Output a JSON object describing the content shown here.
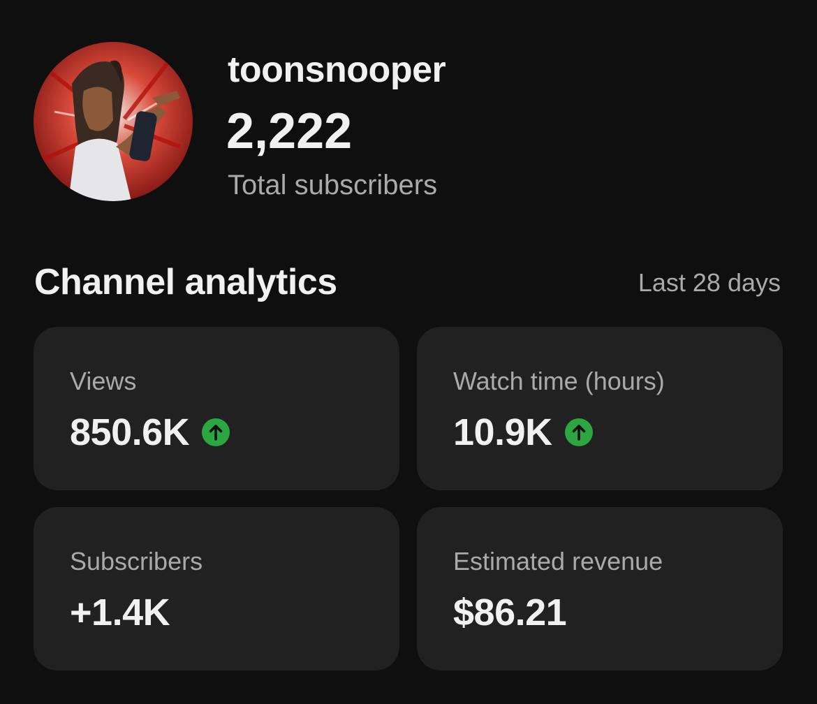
{
  "channel": {
    "name": "toonsnooper",
    "subscriber_count": "2,222",
    "subscriber_caption": "Total subscribers",
    "avatar_icon": "channel-avatar"
  },
  "analytics": {
    "title": "Channel analytics",
    "period": "Last 28 days",
    "accent_up_color": "#2ba640",
    "cards": [
      {
        "label": "Views",
        "value": "850.6K",
        "trend": "up"
      },
      {
        "label": "Watch time (hours)",
        "value": "10.9K",
        "trend": "up"
      },
      {
        "label": "Subscribers",
        "value": "+1.4K",
        "trend": "none"
      },
      {
        "label": "Estimated revenue",
        "value": "$86.21",
        "trend": "none"
      }
    ]
  }
}
